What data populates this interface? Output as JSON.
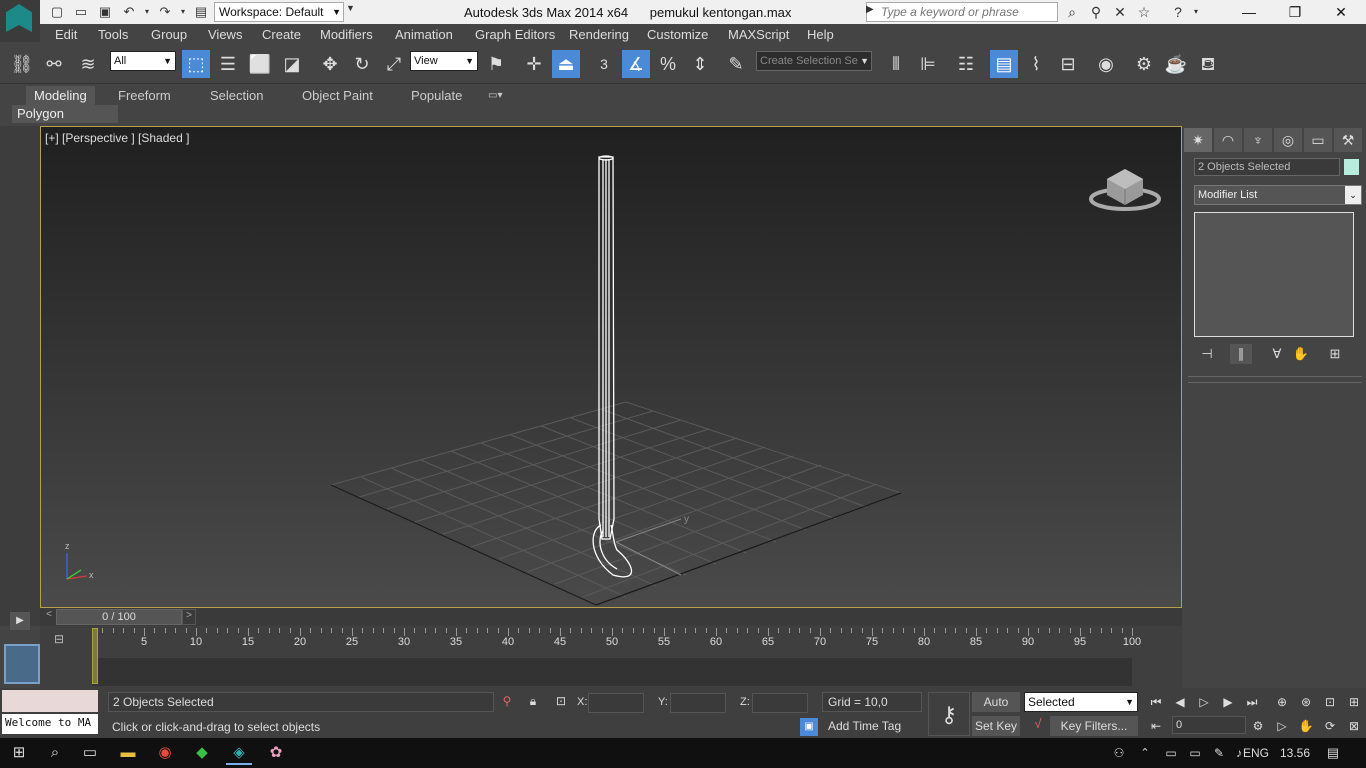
{
  "titlebar": {
    "workspace": "Workspace: Default",
    "app_title": "Autodesk 3ds Max  2014 x64",
    "file_name": "pemukul kentongan.max",
    "search_placeholder": "Type a keyword or phrase"
  },
  "menu": [
    "Edit",
    "Tools",
    "Group",
    "Views",
    "Create",
    "Modifiers",
    "Animation",
    "Graph Editors",
    "Rendering",
    "Customize",
    "MAXScript",
    "Help"
  ],
  "toolbar": {
    "filter_value": "All",
    "ref_coord_value": "View",
    "named_selection_placeholder": "Create Selection Se",
    "snap_label": "3"
  },
  "ribbon": {
    "tabs": [
      "Modeling",
      "Freeform",
      "Selection",
      "Object Paint",
      "Populate"
    ],
    "active_tab": "Modeling",
    "panel": "Polygon Modeling"
  },
  "viewport": {
    "label": "[+] [Perspective ] [Shaded ]",
    "axis_x": "x",
    "axis_y": "y",
    "axis_z": "z"
  },
  "command_panel": {
    "object_name": "2 Objects Selected",
    "object_color": "#b8ecdc",
    "modifier_list": "Modifier List"
  },
  "timeline": {
    "slider_label": "0 / 100",
    "ticks": [
      "5",
      "10",
      "15",
      "20",
      "25",
      "30",
      "35",
      "40",
      "45",
      "50",
      "55",
      "60",
      "65",
      "70",
      "75",
      "80",
      "85",
      "90",
      "95",
      "100"
    ]
  },
  "status": {
    "maxscript_output": "Welcome to MA",
    "selection": "2 Objects Selected",
    "prompt": "Click or click-and-drag to select objects",
    "x_label": "X:",
    "y_label": "Y:",
    "z_label": "Z:",
    "grid": "Grid = 10,0",
    "add_time_tag": "Add Time Tag",
    "auto_key": "Auto Key",
    "set_key": "Set Key",
    "selected_dropdown": "Selected",
    "key_filters": "Key Filters...",
    "frame": "0"
  },
  "taskbar": {
    "language": "ENG",
    "time": "13.56"
  },
  "colors": {
    "viewport_border": "#b8a04a",
    "active_button": "#4a8ad6"
  }
}
